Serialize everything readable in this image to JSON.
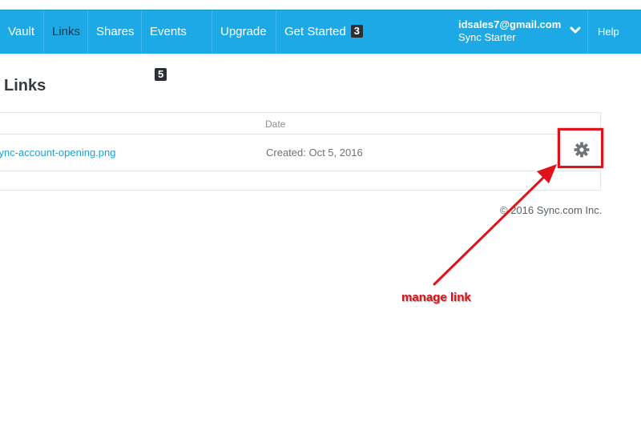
{
  "nav": {
    "vault": "Vault",
    "links": "Links",
    "shares": "Shares",
    "events": "Events",
    "events_count": "5",
    "upgrade": "Upgrade",
    "get_started": "Get Started",
    "get_started_count": "3",
    "help": "Help"
  },
  "account": {
    "email": "idsales7@gmail.com",
    "plan": "Sync Starter"
  },
  "page": {
    "title": "Links"
  },
  "table": {
    "date_header": "Date",
    "rows": [
      {
        "name": "sync-account-opening.png",
        "created": "Created: Oct 5, 2016"
      }
    ]
  },
  "footer": {
    "copyright": "© 2016 Sync.com Inc."
  },
  "annotation": {
    "label": "manage link"
  },
  "colors": {
    "nav_bg": "#1ca9e6",
    "link": "#1ea0d8",
    "annotation": "#e0121b"
  }
}
